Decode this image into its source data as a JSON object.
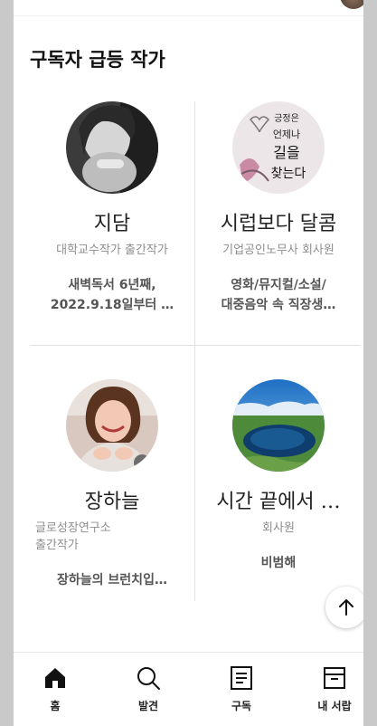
{
  "section": {
    "title": "구독자 급등 작가"
  },
  "authors": [
    {
      "name": "지담",
      "job": "대학교수작가 출간작가",
      "desc_line1": "새벽독서 6년째,",
      "desc_line2": "2022.9.18일부터 …"
    },
    {
      "name": "시럽보다 달콤",
      "job": "기업공인노무사 회사원",
      "desc_line1": "영화/뮤지컬/소설/",
      "desc_line2": "대중음악 속 직장생…"
    },
    {
      "name": "장하늘",
      "job_line1": "글로성장연구소",
      "job_line2": "출간작가",
      "desc_line1": "장하늘의 브런치입…"
    },
    {
      "name": "시간 끝에서 …",
      "job": "회사원",
      "desc_line1": "비범해"
    }
  ],
  "avatar2_text": "궁정은 언제나 길을 찾는다",
  "tabs": [
    {
      "label": "홈",
      "icon": "home-icon"
    },
    {
      "label": "발견",
      "icon": "search-icon"
    },
    {
      "label": "구독",
      "icon": "subscribe-icon"
    },
    {
      "label": "내 서랍",
      "icon": "drawer-icon"
    }
  ],
  "colors": {
    "accent": "#111111",
    "muted": "#8e8e8e",
    "divider": "#e2e2e2"
  }
}
